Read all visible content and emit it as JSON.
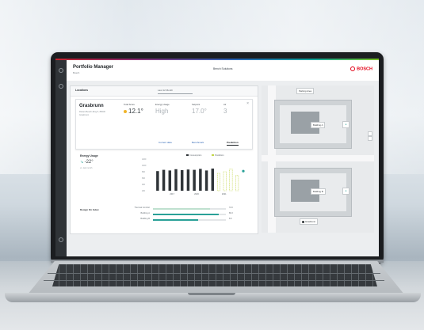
{
  "app": {
    "title": "Portfolio Manager",
    "subtitle": "Bosch",
    "benchmark": "Bench Solutions",
    "brand": "BOSCH"
  },
  "panel": {
    "location_label": "Locations",
    "location_select": "Last 12 Month"
  },
  "building_card": {
    "name": "Grasbrunn",
    "address": "Robert-Bosch-Ring 5, 85630 Grasbrunn",
    "metrics": [
      {
        "label": "Total Score",
        "value": "12.1°"
      },
      {
        "label": "Energy Usage",
        "value": "High"
      },
      {
        "label": "Setpoint",
        "value": "17.0°"
      },
      {
        "label": "Air",
        "value": "3"
      }
    ],
    "tabs": [
      "Current data",
      "Benchmark",
      "Prediction"
    ],
    "active_tab": "Prediction"
  },
  "energy": {
    "label": "Energy Usage",
    "value": "-22°",
    "sub": "vs. last month",
    "legend": [
      "Consumption",
      "Prediction"
    ]
  },
  "chart_data": {
    "type": "bar",
    "categories": [
      "1",
      "2",
      "3",
      "4",
      "5",
      "6",
      "7",
      "8",
      "9",
      "10",
      "11",
      "12",
      "13",
      "14"
    ],
    "series": [
      {
        "name": "Consumption",
        "values": [
          62,
          66,
          64,
          68,
          65,
          67,
          66,
          69,
          64,
          70,
          0,
          0,
          0,
          0
        ]
      },
      {
        "name": "Prediction",
        "values": [
          0,
          0,
          0,
          0,
          0,
          0,
          0,
          0,
          0,
          0,
          55,
          60,
          68,
          48
        ]
      }
    ],
    "xlabels": [
      "2017",
      "2020",
      "2021"
    ],
    "yticks": [
      "1200",
      "1000",
      "800",
      "600",
      "400",
      "200"
    ],
    "ylim": [
      0,
      100
    ],
    "colors": {
      "Consumption": "#2f3438",
      "Prediction": "#c3d64a",
      "marker": "#2aa198"
    }
  },
  "design": {
    "label": "Design On Index",
    "rows": [
      {
        "label": "Thermal Comfort",
        "value": "72.0",
        "fill": 0.78,
        "color": "#bfe0cf"
      },
      {
        "label": "Building A",
        "value": "86.3",
        "fill": 0.9,
        "color": "#2aa198"
      },
      {
        "label": "Building B",
        "value": "8.8",
        "fill": 0.62,
        "color": "#2aa198"
      }
    ]
  },
  "map": {
    "tags": [
      "Building A",
      "Building B"
    ],
    "pin_label": "Grasbrunn",
    "top_label": "Parking Area"
  }
}
